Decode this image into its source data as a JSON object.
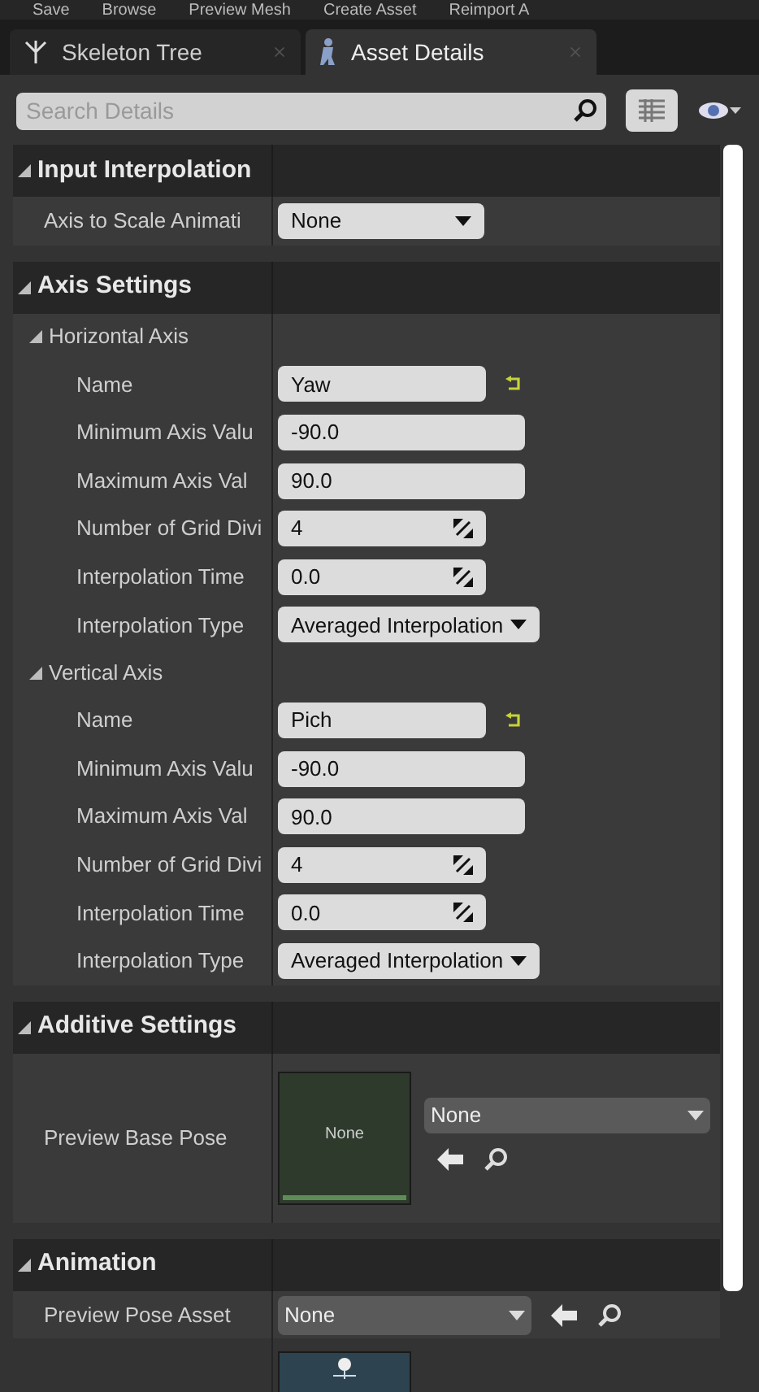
{
  "toolbar": [
    "Save",
    "Browse",
    "Preview Mesh",
    "Create Asset",
    "Reimport A"
  ],
  "tabs": [
    {
      "label": "Skeleton Tree",
      "selected": false
    },
    {
      "label": "Asset Details",
      "selected": true
    }
  ],
  "search": {
    "placeholder": "Search Details"
  },
  "sections": [
    {
      "title": "Input Interpolation",
      "expanded": true,
      "rows": [
        {
          "kind": "combo",
          "label": "Axis to Scale Animati",
          "value": "None"
        }
      ]
    },
    {
      "title": "Axis Settings",
      "expanded": true,
      "rows": [
        {
          "kind": "group",
          "label": "Horizontal Axis",
          "expanded": true,
          "children": [
            {
              "kind": "text",
              "label": "Name",
              "value": "Yaw",
              "resettable": true
            },
            {
              "kind": "value",
              "label": "Minimum Axis Valu",
              "value": "-90.0"
            },
            {
              "kind": "value",
              "label": "Maximum Axis Val",
              "value": "90.0"
            },
            {
              "kind": "spin",
              "label": "Number of Grid Divi",
              "value": "4"
            },
            {
              "kind": "spin",
              "label": "Interpolation Time",
              "value": "0.0"
            },
            {
              "kind": "combo",
              "label": "Interpolation Type",
              "value": "Averaged Interpolation"
            }
          ]
        },
        {
          "kind": "group",
          "label": "Vertical Axis",
          "expanded": true,
          "children": [
            {
              "kind": "text",
              "label": "Name",
              "value": "Pich",
              "resettable": true
            },
            {
              "kind": "value",
              "label": "Minimum Axis Valu",
              "value": "-90.0"
            },
            {
              "kind": "value",
              "label": "Maximum Axis Val",
              "value": "90.0"
            },
            {
              "kind": "spin",
              "label": "Number of Grid Divi",
              "value": "4"
            },
            {
              "kind": "spin",
              "label": "Interpolation Time",
              "value": "0.0"
            },
            {
              "kind": "combo",
              "label": "Interpolation Type",
              "value": "Averaged Interpolation"
            }
          ]
        }
      ]
    },
    {
      "title": "Additive Settings",
      "expanded": true,
      "rows": [
        {
          "kind": "asset",
          "label": "Preview Base Pose",
          "thumb": "None",
          "value": "None"
        }
      ]
    },
    {
      "title": "Animation",
      "expanded": true,
      "rows": [
        {
          "kind": "asset_inline",
          "label": "Preview Pose Asset",
          "value": "None"
        }
      ]
    }
  ]
}
